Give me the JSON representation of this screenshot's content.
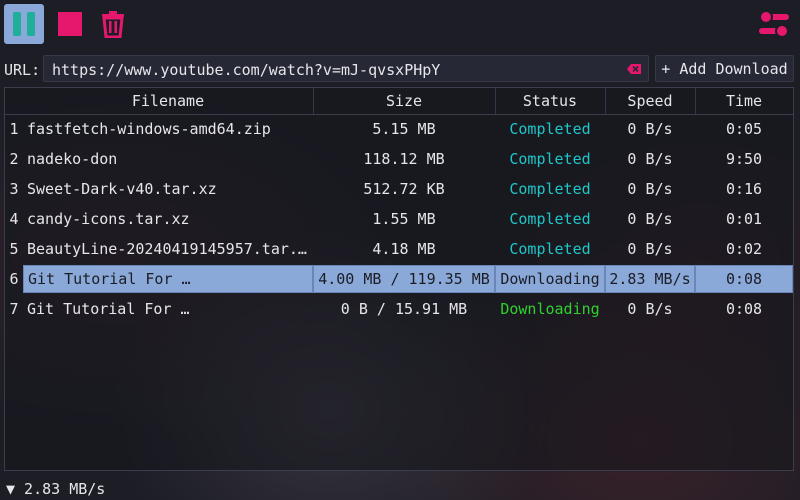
{
  "colors": {
    "accent": "#e6186e",
    "completed": "#1fc6c8",
    "downloading": "#2ed12e",
    "selection": "#8aa8d8"
  },
  "toolbar": {
    "pause_icon": "pause-icon",
    "stop_icon": "stop-icon",
    "delete_icon": "trash-icon",
    "settings_icon": "sliders-icon"
  },
  "url_bar": {
    "label": "URL:",
    "value": "https://www.youtube.com/watch?v=mJ-qvsxPHpY",
    "add_label": "+ Add Download"
  },
  "table": {
    "headers": {
      "filename": "Filename",
      "size": "Size",
      "status": "Status",
      "speed": "Speed",
      "time": "Time"
    },
    "rows": [
      {
        "idx": "1",
        "filename": "fastfetch-windows-amd64.zip",
        "size": "5.15 MB",
        "status": "Completed",
        "speed": "0 B/s",
        "time": "0:05"
      },
      {
        "idx": "2",
        "filename": "nadeko-don",
        "size": "118.12 MB",
        "status": "Completed",
        "speed": "0 B/s",
        "time": "9:50"
      },
      {
        "idx": "3",
        "filename": "Sweet-Dark-v40.tar.xz",
        "size": "512.72 KB",
        "status": "Completed",
        "speed": "0 B/s",
        "time": "0:16"
      },
      {
        "idx": "4",
        "filename": "candy-icons.tar.xz",
        "size": "1.55 MB",
        "status": "Completed",
        "speed": "0 B/s",
        "time": "0:01"
      },
      {
        "idx": "5",
        "filename": "BeautyLine-20240419145957.tar.…",
        "size": "4.18 MB",
        "status": "Completed",
        "speed": "0 B/s",
        "time": "0:02"
      },
      {
        "idx": "6",
        "filename": "Git Tutorial For …",
        "size": "4.00 MB / 119.35 MB",
        "status": "Downloading",
        "speed": "2.83 MB/s",
        "time": "0:08"
      },
      {
        "idx": "7",
        "filename": "Git Tutorial For …",
        "size": "0 B / 15.91 MB",
        "status": "Downloading",
        "speed": "0 B/s",
        "time": "0:08"
      }
    ]
  },
  "statusbar": {
    "text": "▼ 2.83 MB/s"
  }
}
